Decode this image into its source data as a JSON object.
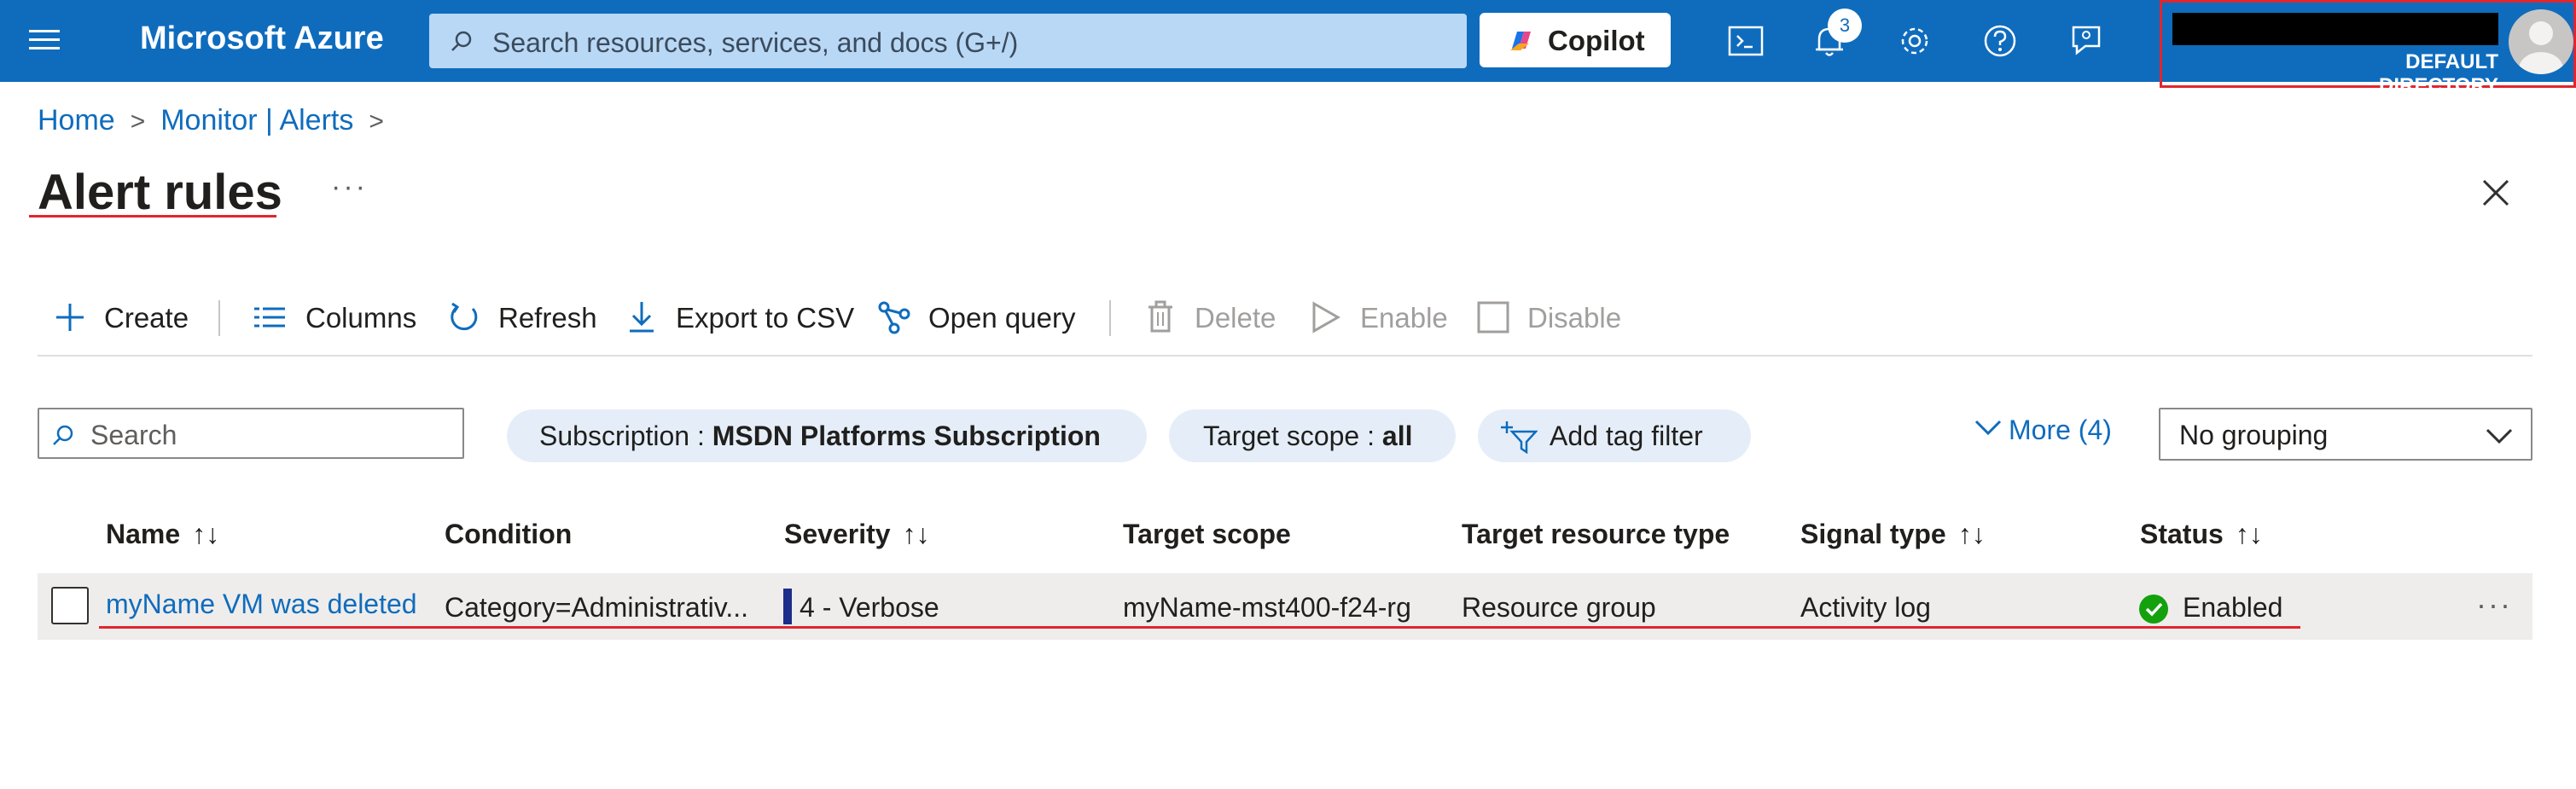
{
  "topbar": {
    "brand": "Microsoft Azure",
    "search_placeholder": "Search resources, services, and docs (G+/)",
    "copilot_label": "Copilot",
    "notification_count": "3",
    "account": {
      "directory": "DEFAULT DIRECTORY"
    }
  },
  "breadcrumb": {
    "items": [
      "Home",
      "Monitor | Alerts"
    ],
    "separator": ">"
  },
  "page": {
    "title": "Alert rules",
    "more": "···"
  },
  "toolbar": {
    "create": "Create",
    "columns": "Columns",
    "refresh": "Refresh",
    "export": "Export to CSV",
    "open_query": "Open query",
    "delete": "Delete",
    "enable": "Enable",
    "disable": "Disable"
  },
  "filters": {
    "search_placeholder": "Search",
    "subscription_label": "Subscription : ",
    "subscription_value": "MSDN Platforms Subscription",
    "scope_label": "Target scope : ",
    "scope_value": "all",
    "add_tag": "Add tag filter",
    "more": "More (4)",
    "grouping": "No grouping"
  },
  "table": {
    "headers": {
      "name": "Name",
      "condition": "Condition",
      "severity": "Severity",
      "target_scope": "Target scope",
      "resource_type": "Target resource type",
      "signal_type": "Signal type",
      "status": "Status",
      "sort_glyph": "↑↓"
    },
    "rows": [
      {
        "name": "myName VM was deleted",
        "condition": "Category=Administrativ...",
        "severity": "4 - Verbose",
        "target_scope": "myName-mst400-f24-rg",
        "resource_type": "Resource group",
        "signal_type": "Activity log",
        "status": "Enabled",
        "more": "···"
      }
    ]
  },
  "colors": {
    "topbar": "#0f6cbd",
    "link": "#0f6cbd",
    "annotation": "#e0262e",
    "status_ok": "#13a10e"
  }
}
